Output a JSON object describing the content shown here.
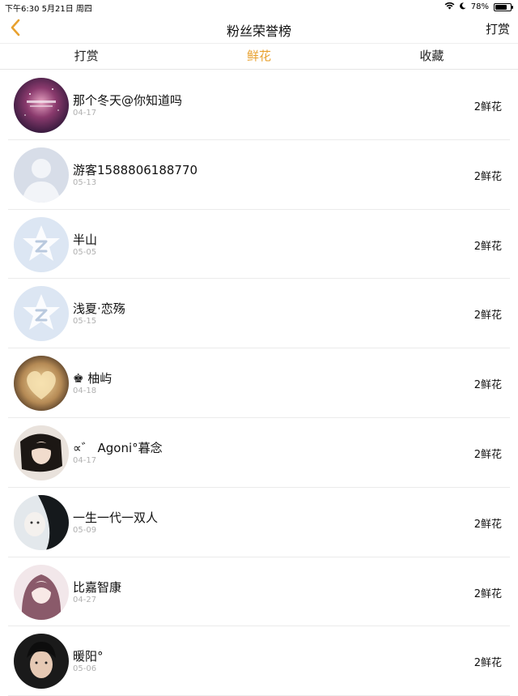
{
  "status": {
    "time_date": "下午6:30   5月21日 周四",
    "battery": "78%",
    "battery_level": 0.78
  },
  "nav": {
    "title": "粉丝荣誉榜",
    "right_label": "打赏"
  },
  "tabs": [
    {
      "label": "打赏"
    },
    {
      "label": "鲜花"
    },
    {
      "label": "收藏"
    }
  ],
  "active_tab": 1,
  "colors": {
    "accent": "#e8a12f"
  },
  "rows": [
    {
      "name": "那个冬天@你知道吗",
      "date": "04-17",
      "count": "2鲜花",
      "avatar": "galaxy"
    },
    {
      "name": "游客1588806188770",
      "date": "05-13",
      "count": "2鲜花",
      "avatar": "default-person"
    },
    {
      "name": "半山",
      "date": "05-05",
      "count": "2鲜花",
      "avatar": "qq-star"
    },
    {
      "name": "浅夏·恋殇",
      "date": "05-15",
      "count": "2鲜花",
      "avatar": "qq-star"
    },
    {
      "name": "♚ 柚屿",
      "date": "04-18",
      "count": "2鲜花",
      "avatar": "heart-photo"
    },
    {
      "name": "∝゛ Agoni°暮念",
      "date": "04-17",
      "count": "2鲜花",
      "avatar": "photo-dark"
    },
    {
      "name": "一生一代一双人",
      "date": "05-09",
      "count": "2鲜花",
      "avatar": "photo-dark"
    },
    {
      "name": "比嘉智康",
      "date": "04-27",
      "count": "2鲜花",
      "avatar": "anime-girl"
    },
    {
      "name": "暖阳°",
      "date": "05-06",
      "count": "2鲜花",
      "avatar": "photo-boy"
    }
  ]
}
